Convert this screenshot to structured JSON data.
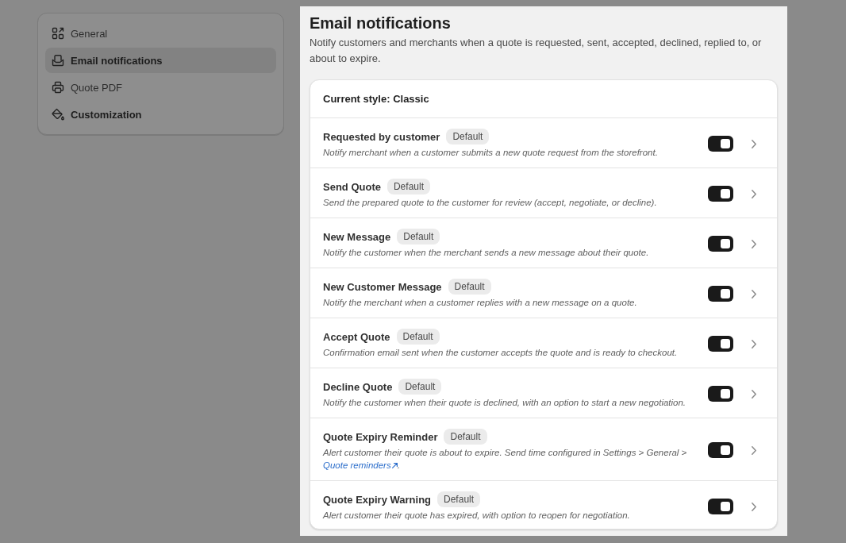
{
  "sidebar": {
    "items": [
      {
        "label": "General",
        "selected": false,
        "emphasized": false
      },
      {
        "label": "Email notifications",
        "selected": true,
        "emphasized": true
      },
      {
        "label": "Quote PDF",
        "selected": false,
        "emphasized": false
      },
      {
        "label": "Customization",
        "selected": false,
        "emphasized": true
      }
    ]
  },
  "main": {
    "title": "Email notifications",
    "description": "Notify customers and merchants when a quote is requested, sent, accepted, declined, replied to, or about to expire.",
    "card": {
      "header": "Current style: Classic",
      "rows": [
        {
          "title": "Requested by customer",
          "badge": "Default",
          "description": "Notify merchant when a customer submits a new quote request from the storefront.",
          "on": true
        },
        {
          "title": "Send Quote",
          "badge": "Default",
          "description": "Send the prepared quote to the customer for review (accept, negotiate, or decline).",
          "on": true
        },
        {
          "title": "New Message",
          "badge": "Default",
          "description": "Notify the customer when the merchant sends a new message about their quote.",
          "on": true
        },
        {
          "title": "New Customer Message",
          "badge": "Default",
          "description": "Notify the merchant when a customer replies with a new message on a quote.",
          "on": true
        },
        {
          "title": "Accept Quote",
          "badge": "Default",
          "description": "Confirmation email sent when the customer accepts the quote and is ready to checkout.",
          "on": true
        },
        {
          "title": "Decline Quote",
          "badge": "Default",
          "description": "Notify the customer when their quote is declined, with an option to start a new negotiation.",
          "on": true
        },
        {
          "title": "Quote Expiry Reminder",
          "badge": "Default",
          "description": "Alert customer their quote is about to expire. Send time configured in Settings > General >",
          "link": "Quote reminders",
          "description_end": ".",
          "on": true
        },
        {
          "title": "Quote Expiry Warning",
          "badge": "Default",
          "description": "Alert customer their quote has expired, with option to reopen for negotiation.",
          "on": true
        }
      ]
    }
  }
}
